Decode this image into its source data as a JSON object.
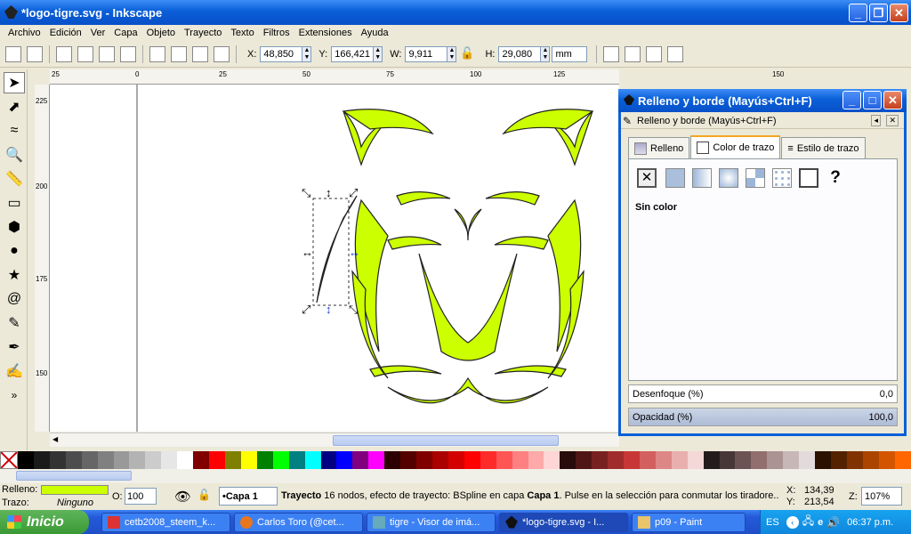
{
  "window": {
    "title": "*logo-tigre.svg - Inkscape"
  },
  "menu": [
    "Archivo",
    "Edición",
    "Ver",
    "Capa",
    "Objeto",
    "Trayecto",
    "Texto",
    "Filtros",
    "Extensiones",
    "Ayuda"
  ],
  "toolbar": {
    "x_label": "X:",
    "x_value": "48,850",
    "y_label": "Y:",
    "y_value": "166,421",
    "w_label": "W:",
    "w_value": "9,911",
    "h_label": "H:",
    "h_value": "29,080",
    "unit": "mm"
  },
  "rulers": {
    "h": [
      "25",
      "0",
      "25",
      "50",
      "75",
      "100",
      "125",
      "150",
      "175"
    ],
    "v": [
      "225",
      "200",
      "175",
      "150"
    ]
  },
  "dialog": {
    "title": "Relleno y borde (Mayús+Ctrl+F)",
    "subtitle": "Relleno y borde (Mayús+Ctrl+F)",
    "tabs": [
      "Relleno",
      "Color de trazo",
      "Estilo de trazo"
    ],
    "paint_state": "Sin color",
    "blur_label": "Desenfoque (%)",
    "blur_value": "0,0",
    "opacity_label": "Opacidad (%)",
    "opacity_value": "100,0"
  },
  "palette": [
    "#000000",
    "#1a1a1a",
    "#333333",
    "#4d4d4d",
    "#666666",
    "#808080",
    "#999999",
    "#b3b3b3",
    "#cccccc",
    "#e6e6e6",
    "#ffffff",
    "#800000",
    "#ff0000",
    "#808000",
    "#ffff00",
    "#008000",
    "#00ff00",
    "#008080",
    "#00ffff",
    "#000080",
    "#0000ff",
    "#800080",
    "#ff00ff",
    "#2b0000",
    "#550000",
    "#800000",
    "#aa0000",
    "#d40000",
    "#ff0000",
    "#ff2a2a",
    "#ff5555",
    "#ff8080",
    "#ffaaaa",
    "#ffd5d5",
    "#280b0b",
    "#501616",
    "#782121",
    "#a02c2c",
    "#c83737",
    "#d35f5f",
    "#de8787",
    "#e9afaf",
    "#f4d7d7",
    "#241c1c",
    "#483737",
    "#6c5353",
    "#916f6f",
    "#ac9393",
    "#c8b7b7",
    "#e3dbdb",
    "#2b1100",
    "#552200",
    "#803300",
    "#aa4400",
    "#d45500",
    "#ff6600"
  ],
  "status": {
    "fill_label": "Relleno:",
    "stroke_label": "Trazo:",
    "stroke_value": "Ninguno",
    "fill_color": "#ccff00",
    "opacity_label": "O:",
    "opacity_value": "100",
    "layer": "•Capa 1",
    "message_bold": "Trayecto",
    "message": " 16 nodos, efecto de trayecto: BSpline en capa ",
    "message_layer": "Capa 1",
    ". Pulse en la selección para conmutar los tiradore...": "",
    "message_tail": ". Pulse en la selección para conmutar los tiradore...",
    "x_label": "X:",
    "x_value": "134,39",
    "y_label": "Y:",
    "y_value": "213,54",
    "z_label": "Z:",
    "zoom": "107%"
  },
  "taskbar": {
    "start": "Inicio",
    "tasks": [
      "cetb2008_steem_k...",
      "Carlos Toro (@cet...",
      "tigre - Visor de imá...",
      "*logo-tigre.svg - I...",
      "p09 - Paint"
    ],
    "lang": "ES",
    "clock": "06:37 p.m."
  }
}
